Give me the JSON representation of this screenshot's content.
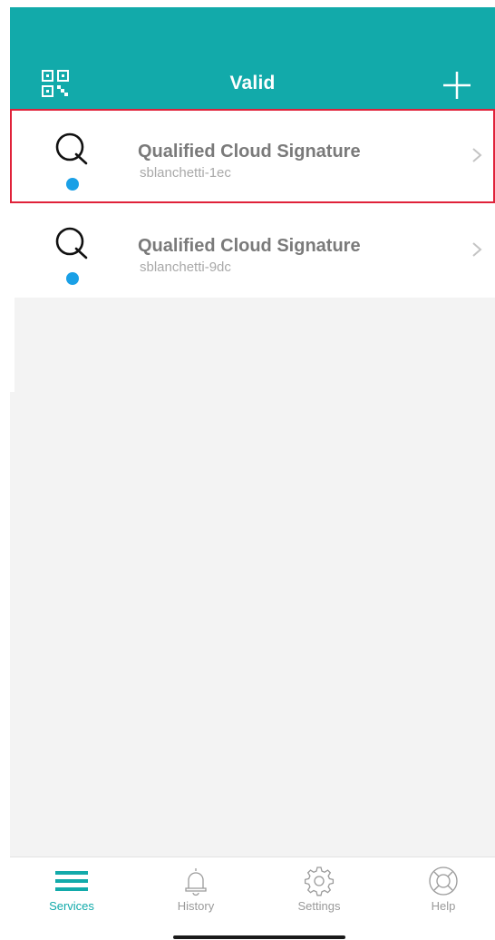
{
  "header": {
    "title": "Valid",
    "left_icon": "qr-code-icon",
    "right_icon": "plus-icon",
    "background_color": "#12aaaa"
  },
  "services": [
    {
      "title": "Qualified Cloud Signature",
      "subtitle": "sblanchetti-1ec",
      "icon": "q-logo-icon",
      "status_color": "#1aa0e6",
      "selected": true
    },
    {
      "title": "Qualified Cloud Signature",
      "subtitle": "sblanchetti-9dc",
      "icon": "q-logo-icon",
      "status_color": "#1aa0e6",
      "selected": false
    }
  ],
  "tabbar": {
    "active_color": "#12aaaa",
    "tabs": [
      {
        "label": "Services",
        "icon": "menu-lines-icon",
        "active": true
      },
      {
        "label": "History",
        "icon": "bell-icon",
        "active": false
      },
      {
        "label": "Settings",
        "icon": "gear-icon",
        "active": false
      },
      {
        "label": "Help",
        "icon": "lifebuoy-icon",
        "active": false
      }
    ]
  }
}
